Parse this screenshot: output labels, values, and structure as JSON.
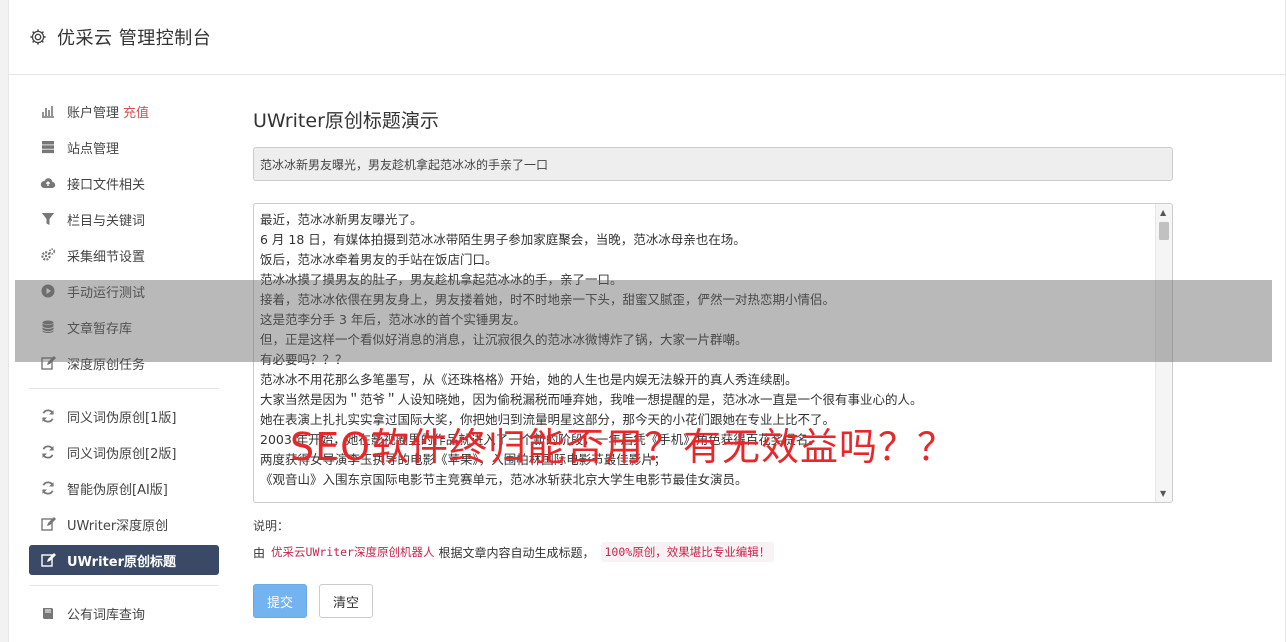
{
  "header": {
    "title": "优采云 管理控制台",
    "icon": "gear-icon"
  },
  "sidebar": {
    "groups": [
      [
        {
          "label": "账户管理",
          "badge": "充值",
          "icon": "bar-chart-icon"
        },
        {
          "label": "站点管理",
          "icon": "server-icon"
        },
        {
          "label": "接口文件相关",
          "icon": "cloud-upload-icon"
        },
        {
          "label": "栏目与关键词",
          "icon": "filter-icon"
        },
        {
          "label": "采集细节设置",
          "icon": "cogs-icon"
        },
        {
          "label": "手动运行测试",
          "icon": "play-circle-icon"
        },
        {
          "label": "文章暂存库",
          "icon": "database-icon"
        },
        {
          "label": "深度原创任务",
          "icon": "edit-icon"
        }
      ],
      [
        {
          "label": "同义词伪原创[1版]",
          "icon": "refresh-icon"
        },
        {
          "label": "同义词伪原创[2版]",
          "icon": "refresh-icon"
        },
        {
          "label": "智能伪原创[AI版]",
          "icon": "refresh-icon"
        },
        {
          "label": "UWriter深度原创",
          "icon": "edit-icon"
        },
        {
          "label": "UWriter原创标题",
          "icon": "edit-icon",
          "active": true
        }
      ],
      [
        {
          "label": "公有词库查询",
          "icon": "book-icon"
        }
      ]
    ]
  },
  "main": {
    "heading": "UWriter原创标题演示",
    "title_value": "范冰冰新男友曝光，男友趁机拿起范冰冰的手亲了一口",
    "content_lines": [
      "最近，范冰冰新男友曝光了。",
      "6 月 18 日，有媒体拍摄到范冰冰带陌生男子参加家庭聚会，当晚，范冰冰母亲也在场。",
      "饭后，范冰冰牵着男友的手站在饭店门口。",
      "范冰冰摸了摸男友的肚子，男友趁机拿起范冰冰的手，亲了一口。",
      "接着，范冰冰依偎在男友身上，男友搂着她，时不时地亲一下头，甜蜜又腻歪，俨然一对热恋期小情侣。",
      "这是范李分手 3 年后，范冰冰的首个实锤男友。",
      "但，正是这样一个看似好消息的消息，让沉寂很久的范冰冰微博炸了锅，大家一片群嘲。",
      "有必要吗？？？",
      "范冰冰不用花那么多笔墨写，从《还珠格格》开始，她的人生也是内娱无法躲开的真人秀连续剧。",
      "大家当然是因为＂范爷＂人设知晓她，因为偷税漏税而唾弃她，我唯一想提醒的是，范冰冰一直是一个很有事业心的人。",
      "她在表演上扎扎实实拿过国际大奖，你把她归到流量明星这部分，那今天的小花们跟她在专业上比不了。",
      "2003 年开始，她在影视圈里的作品就进入了一个新的阶段，一年后凭《手机》角色获得百花奖提名。",
      "两度获得女导演李玉执导的电影《苹果》，入围柏林国际电影节最佳影片；",
      "《观音山》入围东京国际电影节主竞赛单元，范冰冰斩获北京大学生电影节最佳女演员。"
    ],
    "note_label": "说明：",
    "note_prefix": "由",
    "note_code1": "优采云UWriter深度原创机器人",
    "note_middle": "根据文章内容自动生成标题，",
    "note_code2": "100%原创，效果堪比专业编辑！",
    "submit_label": "提交",
    "clear_label": "清空"
  },
  "overlay": {
    "text": "SEO软件终归能否用？有无效益吗？？"
  }
}
